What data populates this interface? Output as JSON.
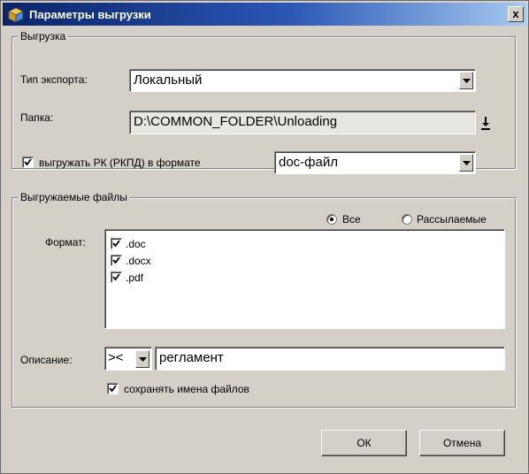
{
  "window": {
    "title": "Параметры выгрузки",
    "close_label": "x"
  },
  "export_group": {
    "legend": "Выгрузка",
    "export_type_label": "Тип экспорта:",
    "export_type_value": "Локальный",
    "folder_label": "Папка:",
    "folder_value": "D:\\COMMON_FOLDER\\Unloading",
    "export_rk_checked": true,
    "export_rk_label": "выгружать РК (РКПД) в формате",
    "format_value": "doc-файл"
  },
  "files_group": {
    "legend": "Выгружаемые файлы",
    "radio_all_label": "Все",
    "radio_all_selected": true,
    "radio_mailed_label": "Рассылаемые",
    "format_label": "Формат:",
    "formats": [
      {
        "label": ".doc",
        "checked": true
      },
      {
        "label": ".docx",
        "checked": true
      },
      {
        "label": ".pdf",
        "checked": true
      }
    ],
    "description_label": "Описание:",
    "description_operator": "><",
    "description_value": "регламент",
    "keep_names_checked": true,
    "keep_names_label": "сохранять имена файлов"
  },
  "buttons": {
    "ok_label": "ОК",
    "cancel_label": "Отмена"
  }
}
